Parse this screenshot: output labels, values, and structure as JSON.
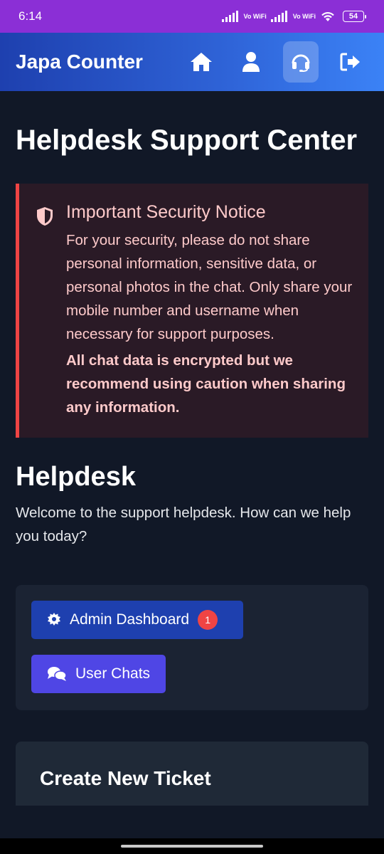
{
  "status_bar": {
    "time": "6:14",
    "network1": "Vo WiFi",
    "network2": "Vo WiFi",
    "battery": "54"
  },
  "header": {
    "title": "Japa Counter",
    "nav": [
      {
        "name": "home",
        "icon": "home-icon"
      },
      {
        "name": "profile",
        "icon": "user-icon"
      },
      {
        "name": "helpdesk",
        "icon": "headset-icon",
        "active": true
      },
      {
        "name": "logout",
        "icon": "logout-icon"
      }
    ]
  },
  "page": {
    "title": "Helpdesk Support Center"
  },
  "notice": {
    "title": "Important Security Notice",
    "text": "For your security, please do not share personal information, sensitive data, or personal photos in the chat. Only share your mobile number and username when necessary for support purposes.",
    "strong": "All chat data is encrypted but we recommend using caution when sharing any information."
  },
  "helpdesk": {
    "title": "Helpdesk",
    "welcome": "Welcome to the support helpdesk. How can we help you today?",
    "admin_label": "Admin Dashboard",
    "admin_badge": "1",
    "chats_label": "User Chats"
  },
  "ticket": {
    "title": "Create New Ticket"
  },
  "colors": {
    "background": "#111827",
    "status_bar": "#8b2fd6",
    "header_gradient_start": "#1e40af",
    "header_gradient_end": "#3b82f6",
    "notice_border": "#ef4444",
    "admin_button": "#1e40af",
    "chats_button": "#4f46e5",
    "badge": "#ef4444"
  }
}
